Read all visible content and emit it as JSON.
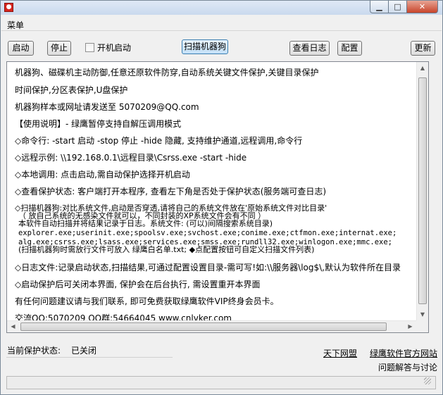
{
  "menubar": {
    "menu_label": "菜单"
  },
  "toolbar": {
    "start_label": "启动",
    "stop_label": "停止",
    "autostart_label": "开机启动",
    "autostart_checked": false,
    "scan_label": "扫描机器狗",
    "view_log_label": "查看日志",
    "config_label": "配置",
    "update_label": "更新"
  },
  "log": {
    "lines": [
      "机器狗、磁碟机主动防御,任意还原软件防穿,自动系统关键文件保护,关键目录保护",
      "时间保护,分区表保护,U盘保护",
      "机器狗样本或网址请发送至 5070209@QQ.com",
      "【使用说明】- 绿鹰暂停支持自解压调用模式",
      "◇命令行: -start 启动  -stop 停止 -hide 隐藏, 支持维护通道,远程调用,命令行",
      "◇远程示例: \\\\192.168.0.1\\远程目录\\Csrss.exe -start -hide",
      "◇本地调用: 点击启动,需自动保护选择开机启动",
      "◇查看保护状态: 客户端打开本程序, 查看左下角是否处于保护状态(服务端可查日志)",
      "◇扫描机器狗:对比系统文件,启动是否穿透,请将自己的系统文件放在'原始系统文件对比目录'",
      "（ 放自己系统的无感染文件就可以，不同封装的XP系统文件会有不同 ）",
      "本软件自动扫描并将结果记录于日志。系统文件: (可以)间隔搜索系统目录)",
      "explorer.exe;userinit.exe;spoolsv.exe;svchost.exe;conime.exe;ctfmon.exe;internat.exe;",
      "alg.exe;csrss.exe;lsass.exe;services.exe;smss.exe;rundll32.exe;winlogon.exe;mmc.exe;",
      "(扫描机器狗时需放行文件可放入 绿鹰白名单.txt; ◆点配置按钮可自定义扫描文件列表)",
      "◇日志文件:记录启动状态,扫描结果,可通过配置设置目录-需可写!如:\\\\服务器\\log$\\,默认为软件所在目录",
      "◇启动保护后可关闭本界面, 保护会在后台执行, 需设置重开本界面",
      "有任何问题建议请与我们联系, 即可免费获取绿鹰软件VIP终身会员卡。",
      "交流QQ:5070209 QQ群:54664045 www.cnlvker.com"
    ]
  },
  "status": {
    "label": "当前保护状态:",
    "value": "已关闭"
  },
  "links": {
    "tianxia": "天下网盟",
    "official_site": "绿鹰软件官方网站",
    "faq": "问题解答与讨论"
  }
}
